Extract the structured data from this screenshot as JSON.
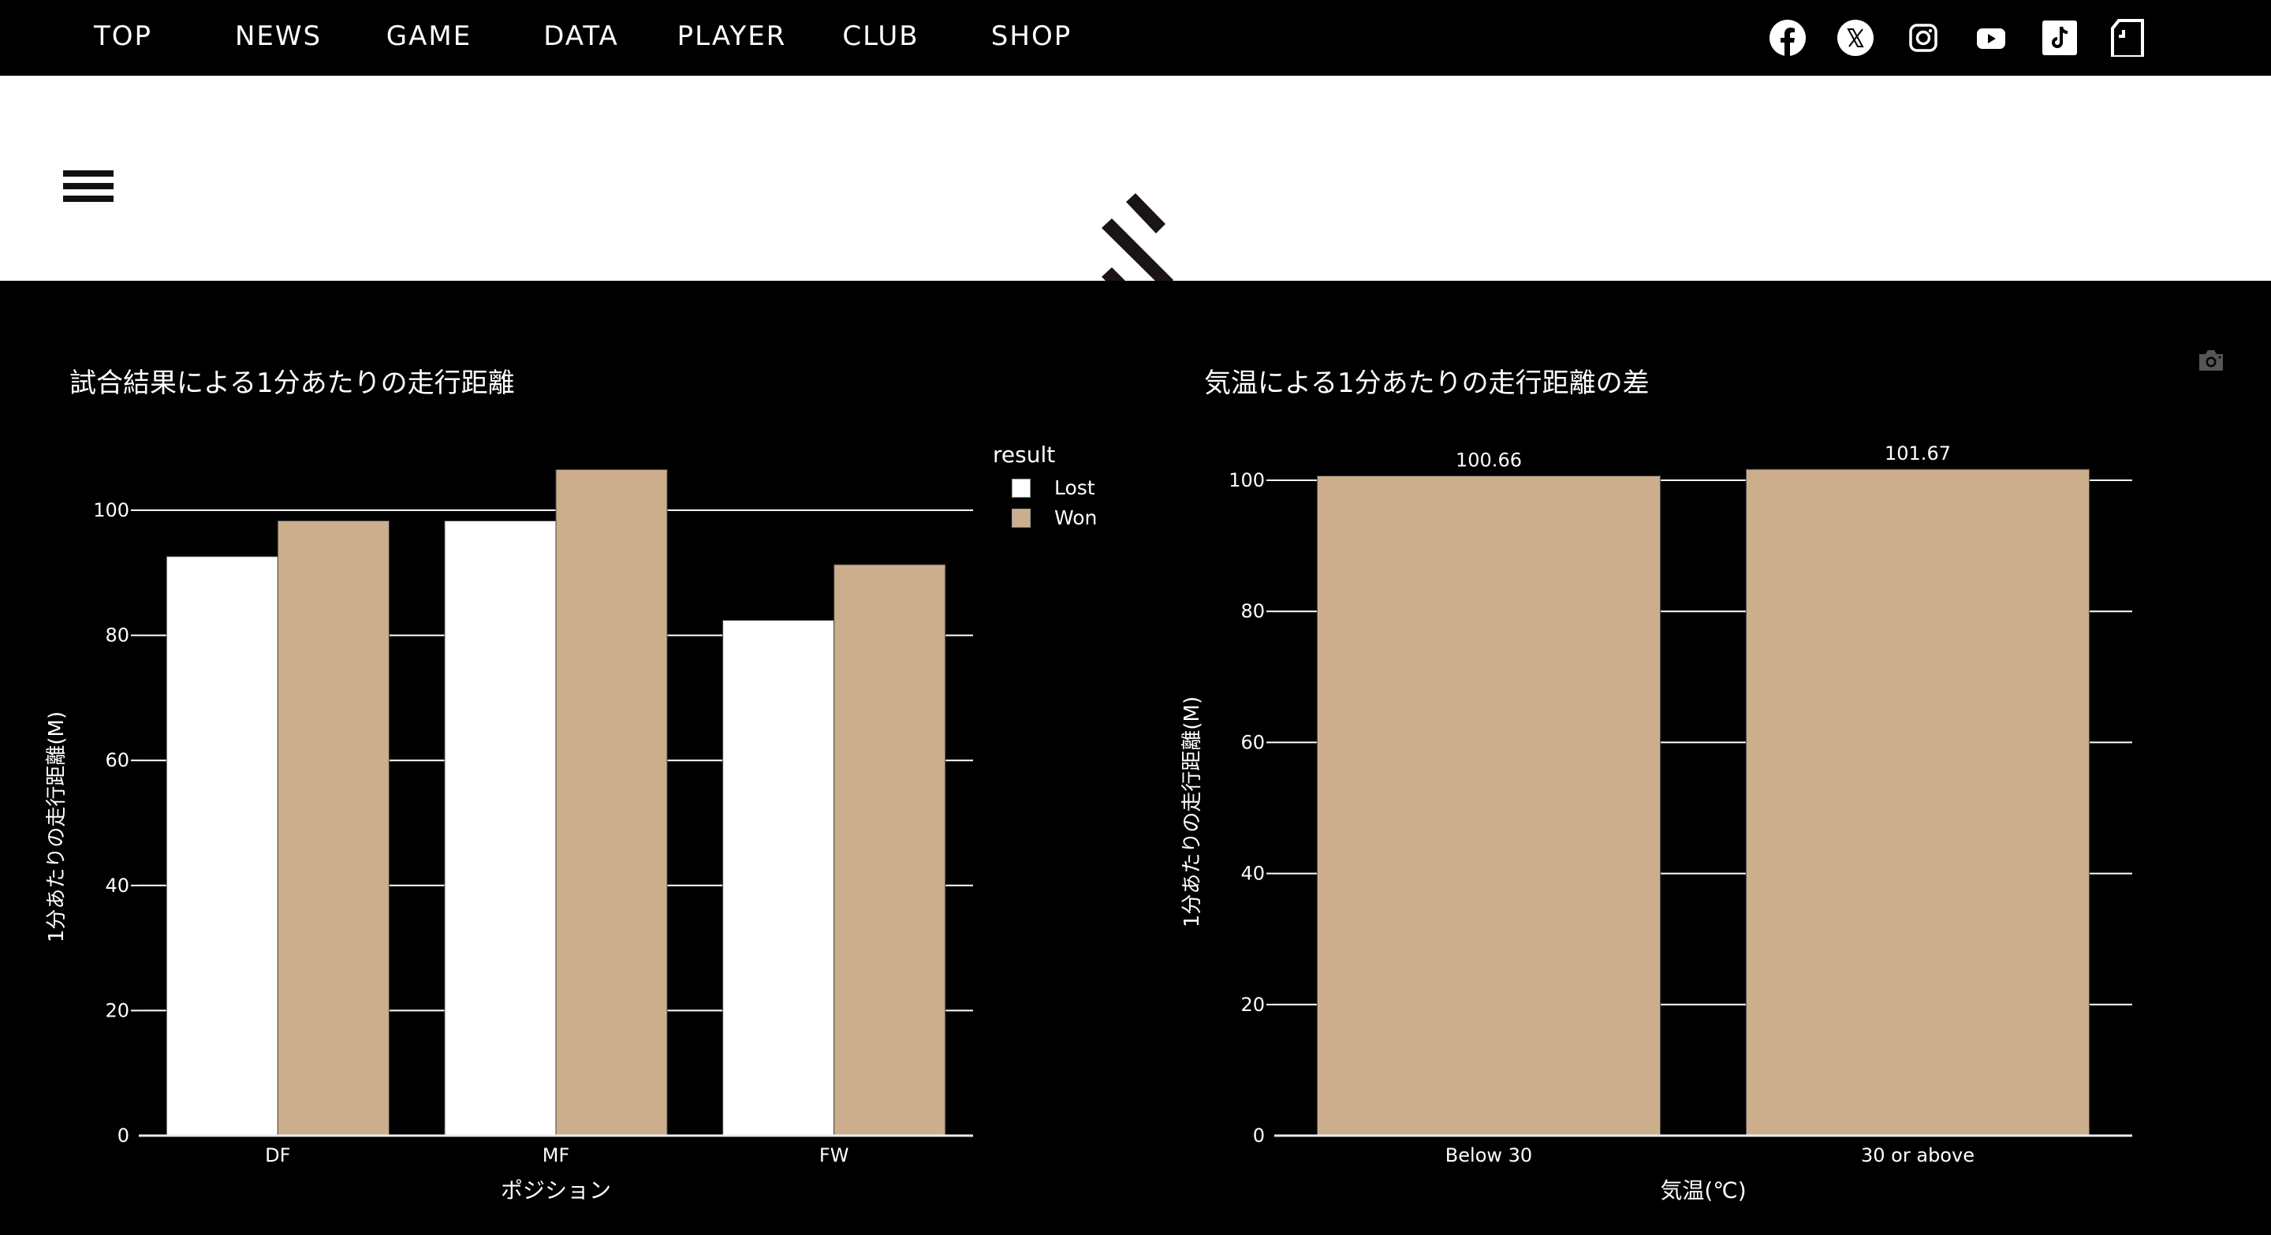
{
  "nav": {
    "items": [
      {
        "label": "TOP"
      },
      {
        "label": "NEWS"
      },
      {
        "label": "GAME"
      },
      {
        "label": "DATA"
      },
      {
        "label": "PLAYER"
      },
      {
        "label": "CLUB"
      },
      {
        "label": "SHOP"
      }
    ],
    "social_icons": [
      "facebook-icon",
      "x-icon",
      "instagram-icon",
      "youtube-icon",
      "tiktok-icon",
      "note-icon"
    ]
  },
  "header": {
    "menu_icon": "hamburger-icon",
    "logo": "club-logo"
  },
  "colors": {
    "lost": "#FFFFFF",
    "won": "#CCAE8D",
    "background": "#000000",
    "grid": "#FFFFFF"
  },
  "chart_data": [
    {
      "type": "bar",
      "title": "試合結果による1分あたりの走行距離",
      "xlabel": "ポジション",
      "ylabel": "1分あたりの走行距離(M)",
      "categories": [
        "DF",
        "MF",
        "FW"
      ],
      "series": [
        {
          "name": "Lost",
          "values": [
            92.6,
            98.3,
            82.4
          ]
        },
        {
          "name": "Won",
          "values": [
            98.3,
            106.5,
            91.3
          ]
        }
      ],
      "ylim": [
        0,
        110
      ],
      "yticks": [
        0,
        20,
        40,
        60,
        80,
        100
      ],
      "grid": true,
      "legend": {
        "title": "result",
        "placement": "top-right"
      }
    },
    {
      "type": "bar",
      "title": "気温による1分あたりの走行距離の差",
      "xlabel": "気温(℃)",
      "ylabel": "1分あたりの走行距離(M)",
      "categories": [
        "Below 30",
        "30 or above"
      ],
      "values": [
        100.66,
        101.67
      ],
      "data_labels": [
        "100.66",
        "101.67"
      ],
      "ylim": [
        0,
        106
      ],
      "yticks": [
        0,
        20,
        40,
        60,
        80,
        100
      ],
      "grid": true
    }
  ],
  "modebar": {
    "camera_icon": "camera-icon"
  }
}
